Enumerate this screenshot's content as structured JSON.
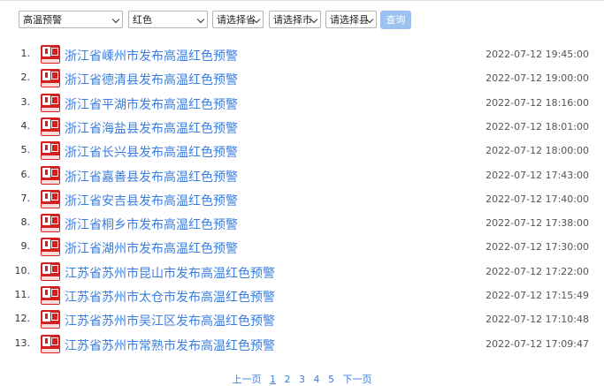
{
  "filters": {
    "warning_type": "高温预警",
    "level": "红色",
    "province": "请选择省",
    "city": "请选择市",
    "county": "请选择县",
    "query_label": "查询"
  },
  "items": [
    {
      "no": "1.",
      "title": "浙江省嵊州市发布高温红色预警",
      "time": "2022-07-12 19:45:00"
    },
    {
      "no": "2.",
      "title": "浙江省德清县发布高温红色预警",
      "time": "2022-07-12 19:00:00"
    },
    {
      "no": "3.",
      "title": "浙江省平湖市发布高温红色预警",
      "time": "2022-07-12 18:16:00"
    },
    {
      "no": "4.",
      "title": "浙江省海盐县发布高温红色预警",
      "time": "2022-07-12 18:01:00"
    },
    {
      "no": "5.",
      "title": "浙江省长兴县发布高温红色预警",
      "time": "2022-07-12 18:00:00"
    },
    {
      "no": "6.",
      "title": "浙江省嘉善县发布高温红色预警",
      "time": "2022-07-12 17:43:00"
    },
    {
      "no": "7.",
      "title": "浙江省安吉县发布高温红色预警",
      "time": "2022-07-12 17:40:00"
    },
    {
      "no": "8.",
      "title": "浙江省桐乡市发布高温红色预警",
      "time": "2022-07-12 17:38:00"
    },
    {
      "no": "9.",
      "title": "浙江省湖州市发布高温红色预警",
      "time": "2022-07-12 17:30:00"
    },
    {
      "no": "10.",
      "title": "江苏省苏州市昆山市发布高温红色预警",
      "time": "2022-07-12 17:22:00"
    },
    {
      "no": "11.",
      "title": "江苏省苏州市太仓市发布高温红色预警",
      "time": "2022-07-12 17:15:49"
    },
    {
      "no": "12.",
      "title": "江苏省苏州市吴江区发布高温红色预警",
      "time": "2022-07-12 17:10:48"
    },
    {
      "no": "13.",
      "title": "江苏省苏州市常熟市发布高温红色预警",
      "time": "2022-07-12 17:09:47"
    }
  ],
  "pager": {
    "prev": "上一页",
    "pages": [
      "1",
      "2",
      "3",
      "4",
      "5"
    ],
    "next": "下一页"
  },
  "colors": {
    "link": "#3b7ee0",
    "warning_red": "#d31f1f",
    "button": "#9cc2f1"
  },
  "icon_name": "high-temperature-red-warning-icon"
}
